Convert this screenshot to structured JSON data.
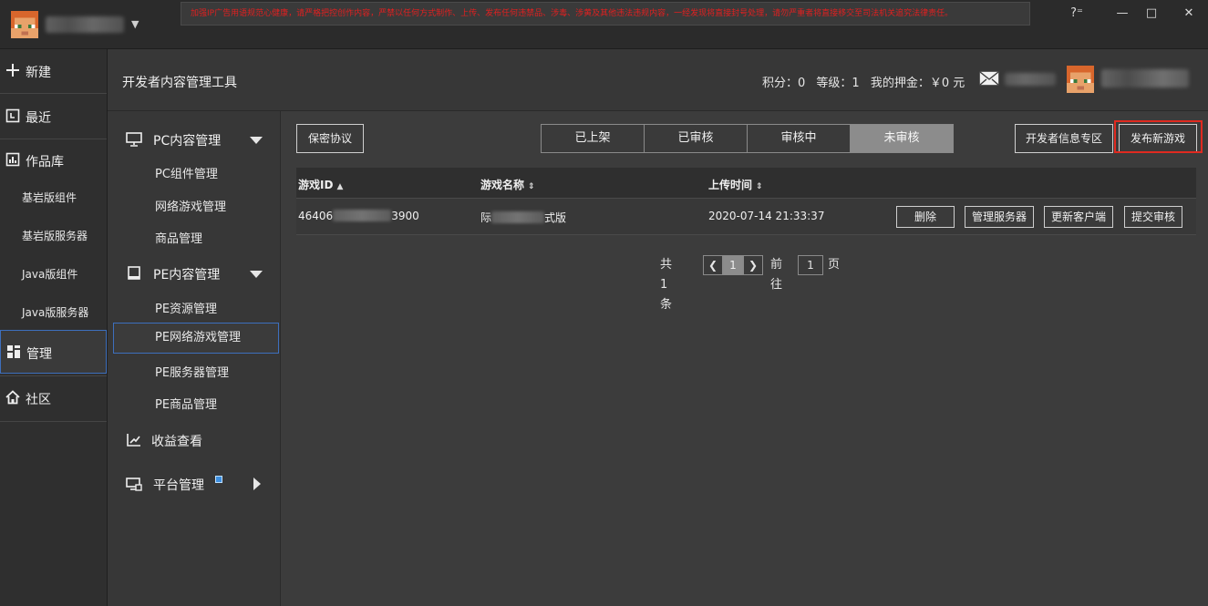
{
  "titlebar": {
    "notice": "加强IP广告用语规范心健康，请严格把控创作内容，严禁以任何方式制作、上传、发布任何违禁品、涉毒、涉黄及其他违法违规内容，一经发现将直接封号处理，请勿严重者将直接移交至司法机关追究法律责任。",
    "help": "?⁼",
    "minimize": "—",
    "maximize": "□",
    "close": "✕",
    "user_caret": "▼"
  },
  "leftnav": {
    "items": [
      {
        "label": "新建",
        "icon": "plus-icon"
      },
      {
        "label": "最近",
        "icon": "recent-icon"
      },
      {
        "label": "作品库",
        "icon": "library-icon"
      },
      {
        "label": "管理",
        "icon": "manage-icon"
      },
      {
        "label": "社区",
        "icon": "home-icon"
      }
    ],
    "subitems": [
      "基岩版组件",
      "基岩版服务器",
      "Java版组件",
      "Java版服务器"
    ]
  },
  "header": {
    "title": "开发者内容管理工具",
    "points": "积分：0",
    "level": "等级：1",
    "deposit": "我的押金：￥0 元"
  },
  "subnav": {
    "pc_group": "PC内容管理",
    "pc_items": [
      "PC组件管理",
      "网络游戏管理",
      "商品管理"
    ],
    "pe_group": "PE内容管理",
    "pe_items": [
      "PE资源管理",
      "PE网络游戏管理",
      "PE服务器管理",
      "PE商品管理"
    ],
    "income": "收益查看",
    "platform": "平台管理"
  },
  "main": {
    "agreement_button": "保密协议",
    "tabs": [
      "已上架",
      "已审核",
      "审核中",
      "未审核"
    ],
    "active_tab": "未审核",
    "developer_zone_button": "开发者信息专区",
    "publish_button": "发布新游戏",
    "table": {
      "headers": [
        "游戏ID",
        "游戏名称",
        "上传时间"
      ],
      "rows": [
        {
          "id_prefix": "46406",
          "id_suffix": "3900",
          "name_prefix": "际",
          "name_suffix": "式版",
          "time": "2020-07-14 21:33:37",
          "actions": [
            "删除",
            "管理服务器",
            "更新客户端",
            "提交审核"
          ]
        }
      ]
    },
    "pagination": {
      "total": "共 1 条",
      "prev": "❮",
      "current": "1",
      "next": "❯",
      "goto_label": "前往",
      "goto_value": "1",
      "page_label": "页"
    }
  }
}
